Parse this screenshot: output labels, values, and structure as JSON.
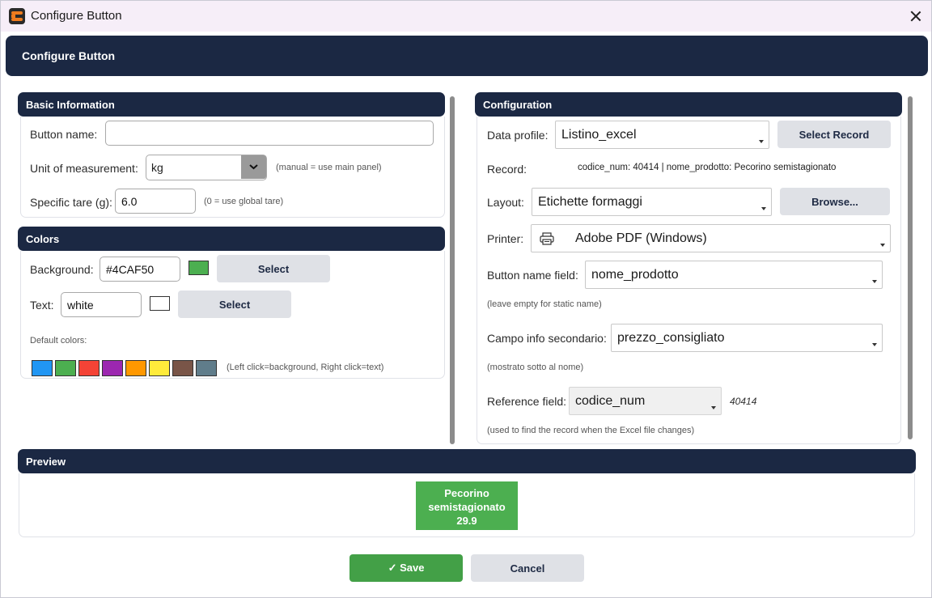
{
  "window": {
    "title": "Configure Button",
    "close_icon": "close-icon"
  },
  "header": {
    "title": "Configure Button"
  },
  "basic": {
    "section_title": "Basic Information",
    "button_name_label": "Button name:",
    "button_name_value": "",
    "unit_label": "Unit of measurement:",
    "unit_value": "kg",
    "unit_hint": "(manual = use main panel)",
    "tare_label": "Specific tare (g):",
    "tare_value": "6.0",
    "tare_hint": "(0 = use global tare)"
  },
  "colors": {
    "section_title": "Colors",
    "background_label": "Background:",
    "background_value": "#4CAF50",
    "background_swatch": "#4caf50",
    "background_select": "Select",
    "text_label": "Text:",
    "text_value": "white",
    "text_swatch": "#ffffff",
    "text_select": "Select",
    "default_label": "Default colors:",
    "palette": [
      "#2196f3",
      "#4caf50",
      "#f44336",
      "#9c27b0",
      "#ff9800",
      "#ffeb3b",
      "#795548",
      "#607d8b"
    ],
    "palette_hint": "(Left click=background, Right click=text)"
  },
  "config": {
    "section_title": "Configuration",
    "data_profile_label": "Data profile:",
    "data_profile_value": "Listino_excel",
    "select_record_button": "Select Record",
    "record_label": "Record:",
    "record_value": "codice_num: 40414 | nome_prodotto: Pecorino semistagionato",
    "layout_label": "Layout:",
    "layout_value": "Etichette formaggi",
    "browse_button": "Browse...",
    "printer_label": "Printer:",
    "printer_value": "Adobe PDF (Windows)",
    "name_field_label": "Button name field:",
    "name_field_value": "nome_prodotto",
    "name_field_hint": "(leave empty for static name)",
    "info_field_label": "Campo info secondario:",
    "info_field_value": "prezzo_consigliato",
    "info_field_hint": "(mostrato sotto al nome)",
    "reference_label": "Reference field:",
    "reference_value": "codice_num",
    "reference_current": "40414",
    "reference_hint": "(used to find the record when the Excel file changes)"
  },
  "preview": {
    "section_title": "Preview",
    "line1": "Pecorino",
    "line2": "semistagionato",
    "line3": "29.9"
  },
  "footer": {
    "save": "✓  Save",
    "cancel": "Cancel"
  }
}
